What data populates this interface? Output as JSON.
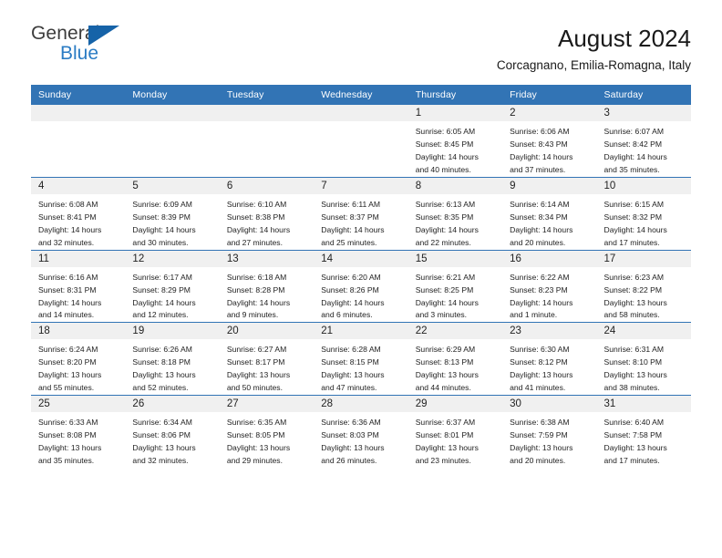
{
  "logo": {
    "word_one": "General",
    "word_two": "Blue",
    "triangle_icon": "blue-triangle-icon"
  },
  "header": {
    "title": "August 2024",
    "subtitle": "Corcagnano, Emilia-Romagna, Italy"
  },
  "colors": {
    "header_blue": "#3274b5",
    "logo_blue": "#2b7cc4",
    "logo_triangle": "#1663a8",
    "daynum_band": "#f0f0f0",
    "text": "#222222"
  },
  "weekdays": [
    "Sunday",
    "Monday",
    "Tuesday",
    "Wednesday",
    "Thursday",
    "Friday",
    "Saturday"
  ],
  "labels": {
    "sunrise_prefix": "Sunrise:",
    "sunset_prefix": "Sunset:",
    "daylight_prefix": "Daylight:"
  },
  "weeks": [
    [
      {
        "day": "",
        "sunrise": "",
        "sunset": "",
        "daylight_line1": "",
        "daylight_line2": ""
      },
      {
        "day": "",
        "sunrise": "",
        "sunset": "",
        "daylight_line1": "",
        "daylight_line2": ""
      },
      {
        "day": "",
        "sunrise": "",
        "sunset": "",
        "daylight_line1": "",
        "daylight_line2": ""
      },
      {
        "day": "",
        "sunrise": "",
        "sunset": "",
        "daylight_line1": "",
        "daylight_line2": ""
      },
      {
        "day": "1",
        "sunrise": "Sunrise: 6:05 AM",
        "sunset": "Sunset: 8:45 PM",
        "daylight_line1": "Daylight: 14 hours",
        "daylight_line2": "and 40 minutes."
      },
      {
        "day": "2",
        "sunrise": "Sunrise: 6:06 AM",
        "sunset": "Sunset: 8:43 PM",
        "daylight_line1": "Daylight: 14 hours",
        "daylight_line2": "and 37 minutes."
      },
      {
        "day": "3",
        "sunrise": "Sunrise: 6:07 AM",
        "sunset": "Sunset: 8:42 PM",
        "daylight_line1": "Daylight: 14 hours",
        "daylight_line2": "and 35 minutes."
      }
    ],
    [
      {
        "day": "4",
        "sunrise": "Sunrise: 6:08 AM",
        "sunset": "Sunset: 8:41 PM",
        "daylight_line1": "Daylight: 14 hours",
        "daylight_line2": "and 32 minutes."
      },
      {
        "day": "5",
        "sunrise": "Sunrise: 6:09 AM",
        "sunset": "Sunset: 8:39 PM",
        "daylight_line1": "Daylight: 14 hours",
        "daylight_line2": "and 30 minutes."
      },
      {
        "day": "6",
        "sunrise": "Sunrise: 6:10 AM",
        "sunset": "Sunset: 8:38 PM",
        "daylight_line1": "Daylight: 14 hours",
        "daylight_line2": "and 27 minutes."
      },
      {
        "day": "7",
        "sunrise": "Sunrise: 6:11 AM",
        "sunset": "Sunset: 8:37 PM",
        "daylight_line1": "Daylight: 14 hours",
        "daylight_line2": "and 25 minutes."
      },
      {
        "day": "8",
        "sunrise": "Sunrise: 6:13 AM",
        "sunset": "Sunset: 8:35 PM",
        "daylight_line1": "Daylight: 14 hours",
        "daylight_line2": "and 22 minutes."
      },
      {
        "day": "9",
        "sunrise": "Sunrise: 6:14 AM",
        "sunset": "Sunset: 8:34 PM",
        "daylight_line1": "Daylight: 14 hours",
        "daylight_line2": "and 20 minutes."
      },
      {
        "day": "10",
        "sunrise": "Sunrise: 6:15 AM",
        "sunset": "Sunset: 8:32 PM",
        "daylight_line1": "Daylight: 14 hours",
        "daylight_line2": "and 17 minutes."
      }
    ],
    [
      {
        "day": "11",
        "sunrise": "Sunrise: 6:16 AM",
        "sunset": "Sunset: 8:31 PM",
        "daylight_line1": "Daylight: 14 hours",
        "daylight_line2": "and 14 minutes."
      },
      {
        "day": "12",
        "sunrise": "Sunrise: 6:17 AM",
        "sunset": "Sunset: 8:29 PM",
        "daylight_line1": "Daylight: 14 hours",
        "daylight_line2": "and 12 minutes."
      },
      {
        "day": "13",
        "sunrise": "Sunrise: 6:18 AM",
        "sunset": "Sunset: 8:28 PM",
        "daylight_line1": "Daylight: 14 hours",
        "daylight_line2": "and 9 minutes."
      },
      {
        "day": "14",
        "sunrise": "Sunrise: 6:20 AM",
        "sunset": "Sunset: 8:26 PM",
        "daylight_line1": "Daylight: 14 hours",
        "daylight_line2": "and 6 minutes."
      },
      {
        "day": "15",
        "sunrise": "Sunrise: 6:21 AM",
        "sunset": "Sunset: 8:25 PM",
        "daylight_line1": "Daylight: 14 hours",
        "daylight_line2": "and 3 minutes."
      },
      {
        "day": "16",
        "sunrise": "Sunrise: 6:22 AM",
        "sunset": "Sunset: 8:23 PM",
        "daylight_line1": "Daylight: 14 hours",
        "daylight_line2": "and 1 minute."
      },
      {
        "day": "17",
        "sunrise": "Sunrise: 6:23 AM",
        "sunset": "Sunset: 8:22 PM",
        "daylight_line1": "Daylight: 13 hours",
        "daylight_line2": "and 58 minutes."
      }
    ],
    [
      {
        "day": "18",
        "sunrise": "Sunrise: 6:24 AM",
        "sunset": "Sunset: 8:20 PM",
        "daylight_line1": "Daylight: 13 hours",
        "daylight_line2": "and 55 minutes."
      },
      {
        "day": "19",
        "sunrise": "Sunrise: 6:26 AM",
        "sunset": "Sunset: 8:18 PM",
        "daylight_line1": "Daylight: 13 hours",
        "daylight_line2": "and 52 minutes."
      },
      {
        "day": "20",
        "sunrise": "Sunrise: 6:27 AM",
        "sunset": "Sunset: 8:17 PM",
        "daylight_line1": "Daylight: 13 hours",
        "daylight_line2": "and 50 minutes."
      },
      {
        "day": "21",
        "sunrise": "Sunrise: 6:28 AM",
        "sunset": "Sunset: 8:15 PM",
        "daylight_line1": "Daylight: 13 hours",
        "daylight_line2": "and 47 minutes."
      },
      {
        "day": "22",
        "sunrise": "Sunrise: 6:29 AM",
        "sunset": "Sunset: 8:13 PM",
        "daylight_line1": "Daylight: 13 hours",
        "daylight_line2": "and 44 minutes."
      },
      {
        "day": "23",
        "sunrise": "Sunrise: 6:30 AM",
        "sunset": "Sunset: 8:12 PM",
        "daylight_line1": "Daylight: 13 hours",
        "daylight_line2": "and 41 minutes."
      },
      {
        "day": "24",
        "sunrise": "Sunrise: 6:31 AM",
        "sunset": "Sunset: 8:10 PM",
        "daylight_line1": "Daylight: 13 hours",
        "daylight_line2": "and 38 minutes."
      }
    ],
    [
      {
        "day": "25",
        "sunrise": "Sunrise: 6:33 AM",
        "sunset": "Sunset: 8:08 PM",
        "daylight_line1": "Daylight: 13 hours",
        "daylight_line2": "and 35 minutes."
      },
      {
        "day": "26",
        "sunrise": "Sunrise: 6:34 AM",
        "sunset": "Sunset: 8:06 PM",
        "daylight_line1": "Daylight: 13 hours",
        "daylight_line2": "and 32 minutes."
      },
      {
        "day": "27",
        "sunrise": "Sunrise: 6:35 AM",
        "sunset": "Sunset: 8:05 PM",
        "daylight_line1": "Daylight: 13 hours",
        "daylight_line2": "and 29 minutes."
      },
      {
        "day": "28",
        "sunrise": "Sunrise: 6:36 AM",
        "sunset": "Sunset: 8:03 PM",
        "daylight_line1": "Daylight: 13 hours",
        "daylight_line2": "and 26 minutes."
      },
      {
        "day": "29",
        "sunrise": "Sunrise: 6:37 AM",
        "sunset": "Sunset: 8:01 PM",
        "daylight_line1": "Daylight: 13 hours",
        "daylight_line2": "and 23 minutes."
      },
      {
        "day": "30",
        "sunrise": "Sunrise: 6:38 AM",
        "sunset": "Sunset: 7:59 PM",
        "daylight_line1": "Daylight: 13 hours",
        "daylight_line2": "and 20 minutes."
      },
      {
        "day": "31",
        "sunrise": "Sunrise: 6:40 AM",
        "sunset": "Sunset: 7:58 PM",
        "daylight_line1": "Daylight: 13 hours",
        "daylight_line2": "and 17 minutes."
      }
    ]
  ]
}
